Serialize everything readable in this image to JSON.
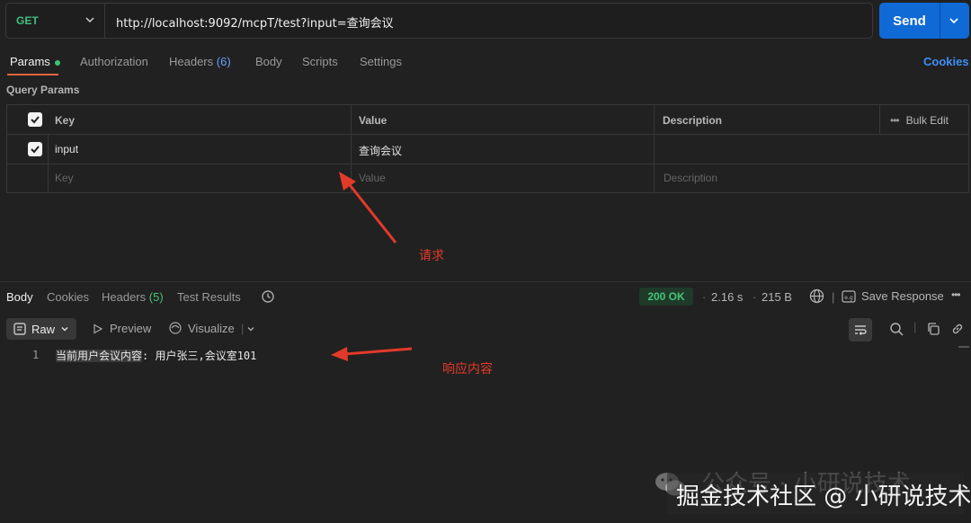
{
  "request": {
    "method": "GET",
    "url": "http://localhost:9092/mcpT/test?input=查询会议",
    "send_label": "Send"
  },
  "request_tabs": [
    {
      "label": "Params"
    },
    {
      "label": "Authorization"
    },
    {
      "label": "Headers",
      "count": "(6)"
    },
    {
      "label": "Body"
    },
    {
      "label": "Scripts"
    },
    {
      "label": "Settings"
    }
  ],
  "cookies_link": "Cookies",
  "query_params": {
    "section_label": "Query Params",
    "headers": {
      "key": "Key",
      "value": "Value",
      "description": "Description",
      "bulk_edit": "Bulk Edit"
    },
    "rows": [
      {
        "checked": true,
        "key": "input",
        "value": "查询会议",
        "description": ""
      }
    ],
    "placeholders": {
      "key": "Key",
      "value": "Value",
      "description": "Description"
    }
  },
  "annotations": {
    "request": "请求",
    "response": "响应内容",
    "color": "#e23a2a"
  },
  "response_tabs": [
    {
      "label": "Body"
    },
    {
      "label": "Cookies"
    },
    {
      "label": "Headers",
      "count": "(5)"
    },
    {
      "label": "Test Results"
    }
  ],
  "response_meta": {
    "status": "200 OK",
    "time": "2.16 s",
    "size": "215 B",
    "save_response": "Save Response"
  },
  "response_toolbar": {
    "format": "Raw",
    "preview": "Preview",
    "visualize": "Visualize"
  },
  "response_body": {
    "lines": [
      {
        "no": "1",
        "highlighted": "当前用户会议内容",
        "rest": ": 用户张三,会议室101"
      }
    ]
  },
  "watermark": {
    "back": "公众号 · 小研说技术",
    "front": "掘金技术社区 @ 小研说技术"
  },
  "colors": {
    "send": "#0f6ad6",
    "method": "#3fbf7f",
    "status_ok": "#46c47a",
    "tab_active_underline": "#e7643c"
  }
}
